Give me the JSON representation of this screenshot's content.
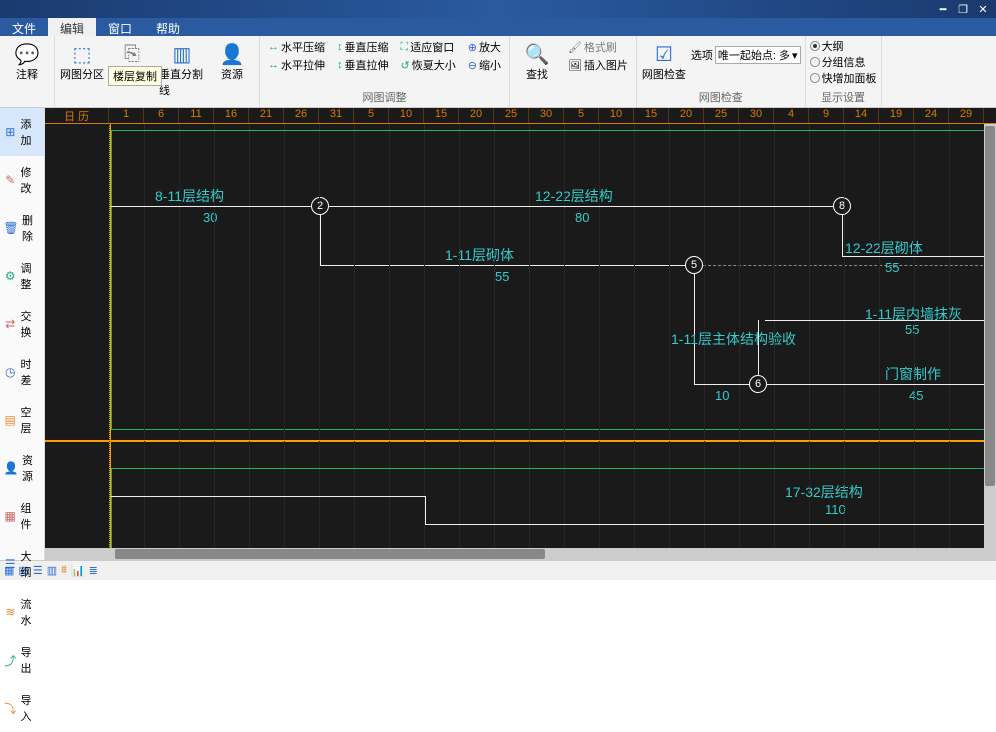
{
  "tabs": {
    "file": "文件",
    "edit": "编辑",
    "window": "窗口",
    "help": "帮助"
  },
  "ribbon": {
    "annotate": "注释",
    "partition": "网图分区",
    "copylayer": "楼层复制",
    "vsplit": "垂直分割线",
    "resource": "资源",
    "hcompress": "水平压缩",
    "vcompress": "垂直压缩",
    "fitwin": "适应窗口",
    "zoomin": "放大",
    "hstretch": "水平拉伸",
    "vstretch": "垂直拉伸",
    "resetsize": "恢夏大小",
    "zoomout": "缩小",
    "adjust_label": "网图调整",
    "find": "查找",
    "formatbrush": "格式刷",
    "insertpic": "插入图片",
    "netcheck": "网图检查",
    "check_label": "网图检查",
    "option_label": "选项",
    "option_value": "唯一起始点: 多",
    "r_outline": "大纲",
    "r_groupinfo": "分组信息",
    "r_quickpanel": "快增加面板",
    "display_label": "显示设置",
    "tooltip": "楼层复制"
  },
  "side": {
    "add": "添加",
    "modify": "修改",
    "delete": "删除",
    "adjust": "调整",
    "swap": "交换",
    "lag": "时差",
    "layer": "空层",
    "res": "资源",
    "comp": "组件",
    "outline": "大纲",
    "seq": "流水",
    "export": "导出",
    "import": "导入"
  },
  "ruler": [
    "日 历",
    "1",
    "6",
    "11",
    "16",
    "21",
    "26",
    "31",
    "5",
    "10",
    "15",
    "20",
    "25",
    "30",
    "5",
    "10",
    "15",
    "20",
    "25",
    "30",
    "4",
    "9",
    "14",
    "19",
    "24",
    "29"
  ],
  "chart_data": {
    "type": "network-schedule",
    "tasks": [
      {
        "id": "t1",
        "label": "8-11层结构",
        "dur": "30"
      },
      {
        "id": "t2",
        "label": "12-22层结构",
        "dur": "80"
      },
      {
        "id": "t3",
        "label": "1-11层砌体",
        "dur": "55"
      },
      {
        "id": "t4",
        "label": "12-22层砌体",
        "dur": "55"
      },
      {
        "id": "t5",
        "label": "1-11层内墙抹灰",
        "dur": "55"
      },
      {
        "id": "t6",
        "label": "1-11层主体结构验收",
        "dur": "10"
      },
      {
        "id": "t7",
        "label": "门窗制作",
        "dur": "45"
      },
      {
        "id": "t8",
        "label": "17-32层结构",
        "dur": "110"
      }
    ],
    "nodes": [
      "2",
      "5",
      "6",
      "8"
    ]
  },
  "status": {
    "coords": "",
    "date": "",
    "mid": "",
    "scale": ""
  }
}
